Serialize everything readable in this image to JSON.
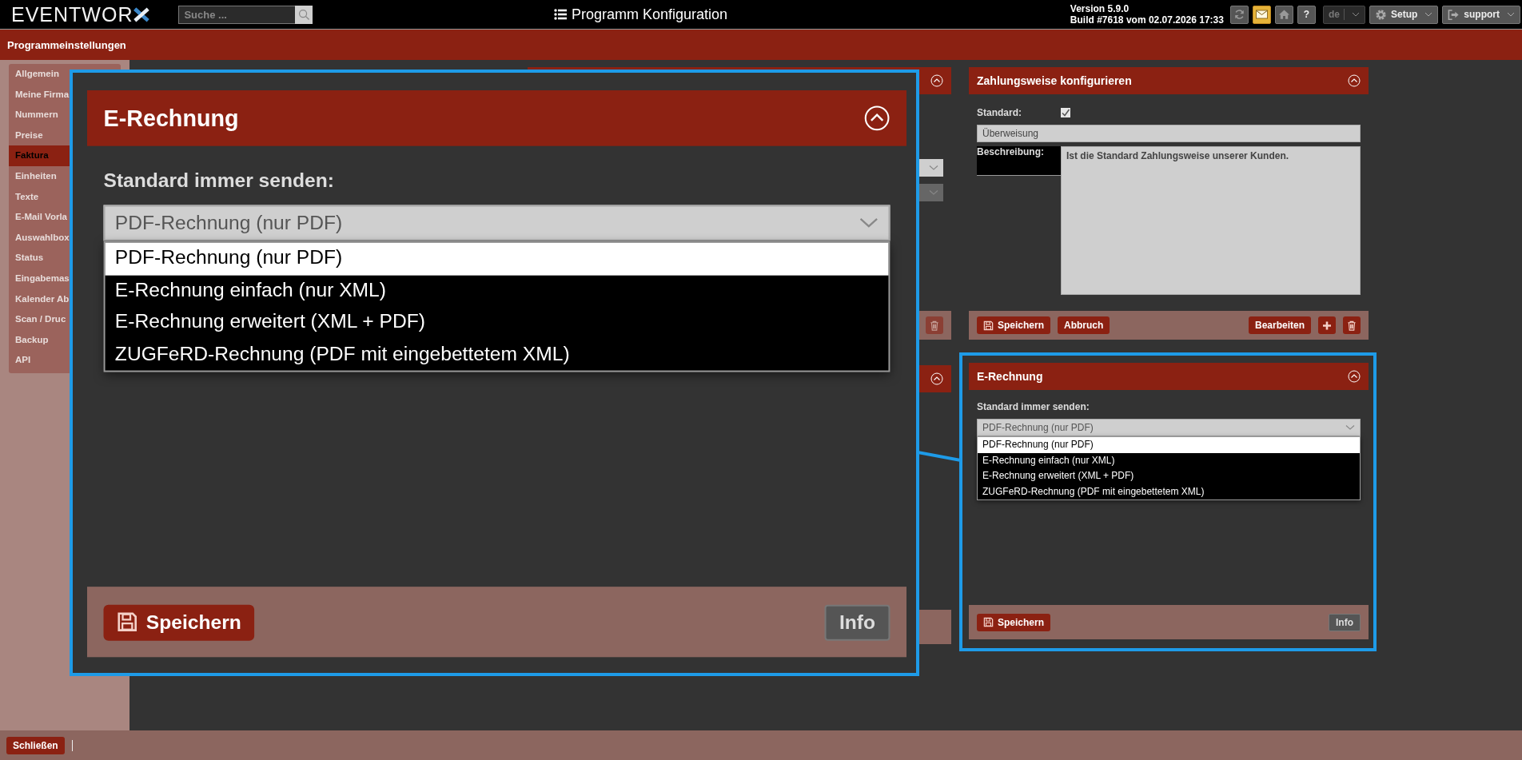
{
  "topbar": {
    "logo": "EVENTWOR",
    "search": {
      "placeholder": "Suche ..."
    },
    "title": "Programm Konfiguration",
    "version": "Version 5.9.0",
    "build": "Build #7618 vom 02.07.2026 17:33",
    "buttons": [
      {
        "kind": "refresh",
        "highlighted": false
      },
      {
        "kind": "mail",
        "highlighted": true
      },
      {
        "kind": "home",
        "highlighted": false
      },
      {
        "kind": "help",
        "label": "?",
        "highlighted": false
      }
    ],
    "language": "de",
    "setup": "Setup",
    "user": "support"
  },
  "header": {
    "title": "Programmeinstellungen"
  },
  "sidebar": {
    "items": [
      {
        "label": "Allgemein",
        "selected": false
      },
      {
        "label": "Meine Firma",
        "selected": false
      },
      {
        "label": "Nummern",
        "selected": false
      },
      {
        "label": "Preise",
        "selected": false
      },
      {
        "label": "Faktura",
        "selected": true
      },
      {
        "label": "Einheiten",
        "selected": false
      },
      {
        "label": "Texte",
        "selected": false
      },
      {
        "label": "E-Mail Vorla",
        "selected": false
      },
      {
        "label": "Auswahlbox",
        "selected": false
      },
      {
        "label": "Status",
        "selected": false
      },
      {
        "label": "Eingabemas",
        "selected": false
      },
      {
        "label": "Kalender Ab",
        "selected": false
      },
      {
        "label": "Scan / Druc",
        "selected": false
      },
      {
        "label": "Backup",
        "selected": false
      },
      {
        "label": "API",
        "selected": false
      }
    ]
  },
  "middle_column": {
    "selects": [
      {
        "disabled": false
      },
      {
        "disabled": true
      }
    ]
  },
  "payment_panel": {
    "title": "Zahlungsweise konfigurieren",
    "standard_label": "Standard:",
    "standard_checked": true,
    "name_value": "Überweisung",
    "description_label": "Beschreibung:",
    "description_value": "Ist die Standard Zahlungsweise unserer Kunden.",
    "buttons": {
      "save": "Speichern",
      "cancel": "Abbruch",
      "edit": "Bearbeiten"
    }
  },
  "erechnung_panel": {
    "title": "E-Rechnung",
    "label": "Standard immer senden:",
    "value": "PDF-Rechnung (nur PDF)",
    "options": [
      {
        "label": "PDF-Rechnung (nur PDF)",
        "selected": true
      },
      {
        "label": "E-Rechnung einfach (nur XML)",
        "selected": false
      },
      {
        "label": "E-Rechnung erweitert (XML + PDF)",
        "selected": false
      },
      {
        "label": "ZUGFeRD-Rechnung (PDF mit eingebettetem XML)",
        "selected": false
      }
    ],
    "save": "Speichern",
    "info": "Info"
  },
  "magnifier": {
    "panel": {
      "title": "E-Rechnung",
      "label": "Standard immer senden:",
      "value": "PDF-Rechnung (nur PDF)",
      "options": [
        {
          "label": "PDF-Rechnung (nur PDF)",
          "selected": true
        },
        {
          "label": "E-Rechnung einfach (nur XML)",
          "selected": false
        },
        {
          "label": "E-Rechnung erweitert (XML + PDF)",
          "selected": false
        },
        {
          "label": "ZUGFeRD-Rechnung (PDF mit eingebettetem XML)",
          "selected": false
        }
      ],
      "save": "Speichern",
      "info": "Info"
    }
  },
  "footer": {
    "close": "Schließen"
  }
}
